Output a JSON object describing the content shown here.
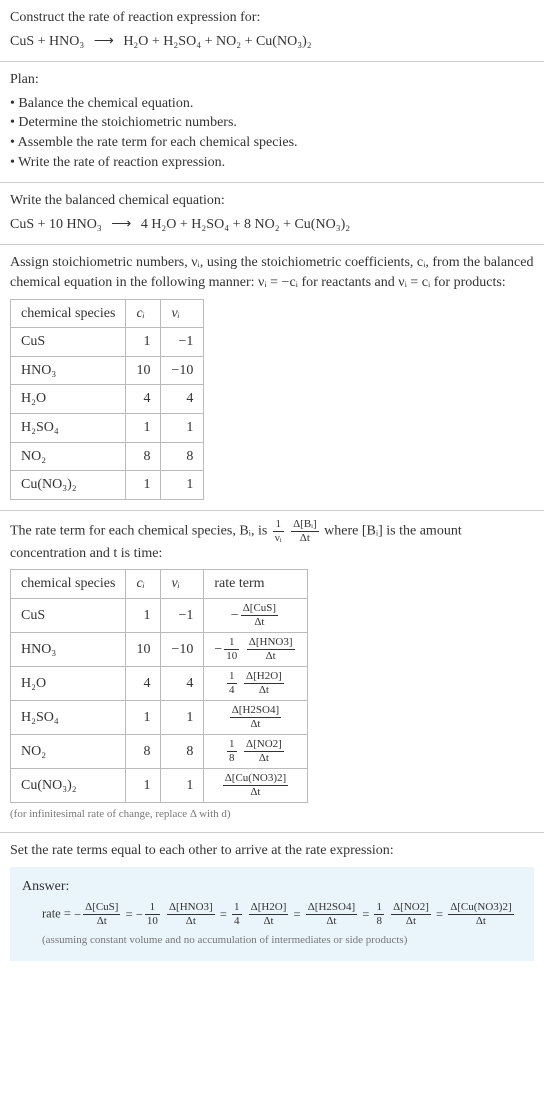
{
  "prompt": {
    "line1": "Construct the rate of reaction expression for:",
    "equation_lhs": "CuS + HNO₃",
    "equation_rhs": "H₂O + H₂SO₄ + NO₂ + Cu(NO₃)₂"
  },
  "plan": {
    "header": "Plan:",
    "items": [
      "Balance the chemical equation.",
      "Determine the stoichiometric numbers.",
      "Assemble the rate term for each chemical species.",
      "Write the rate of reaction expression."
    ]
  },
  "balanced": {
    "header": "Write the balanced chemical equation:",
    "equation_lhs": "CuS + 10 HNO₃",
    "equation_rhs": "4 H₂O + H₂SO₄ + 8 NO₂ + Cu(NO₃)₂"
  },
  "stoich_intro": "Assign stoichiometric numbers, νᵢ, using the stoichiometric coefficients, cᵢ, from the balanced chemical equation in the following manner: νᵢ = −cᵢ for reactants and νᵢ = cᵢ for products:",
  "stoich_table": {
    "headers": [
      "chemical species",
      "cᵢ",
      "νᵢ"
    ],
    "rows": [
      {
        "species": "CuS",
        "c": "1",
        "v": "−1"
      },
      {
        "species": "HNO₃",
        "c": "10",
        "v": "−10"
      },
      {
        "species": "H₂O",
        "c": "4",
        "v": "4"
      },
      {
        "species": "H₂SO₄",
        "c": "1",
        "v": "1"
      },
      {
        "species": "NO₂",
        "c": "8",
        "v": "8"
      },
      {
        "species": "Cu(NO₃)₂",
        "c": "1",
        "v": "1"
      }
    ]
  },
  "rate_intro_1": "The rate term for each chemical species, Bᵢ, is ",
  "rate_intro_2": " where [Bᵢ] is the amount concentration and t is time:",
  "rate_frac_left_top": "1",
  "rate_frac_left_bot": "νᵢ",
  "rate_frac_right_top": "Δ[Bᵢ]",
  "rate_frac_right_bot": "Δt",
  "rate_table": {
    "headers": [
      "chemical species",
      "cᵢ",
      "νᵢ",
      "rate term"
    ],
    "rows": [
      {
        "species": "CuS",
        "c": "1",
        "v": "−1",
        "pref": "−",
        "top": "Δ[CuS]",
        "bot": "Δt"
      },
      {
        "species": "HNO₃",
        "c": "10",
        "v": "−10",
        "pref": "−",
        "coef_top": "1",
        "coef_bot": "10",
        "top": "Δ[HNO3]",
        "bot": "Δt"
      },
      {
        "species": "H₂O",
        "c": "4",
        "v": "4",
        "pref": "",
        "coef_top": "1",
        "coef_bot": "4",
        "top": "Δ[H2O]",
        "bot": "Δt"
      },
      {
        "species": "H₂SO₄",
        "c": "1",
        "v": "1",
        "pref": "",
        "top": "Δ[H2SO4]",
        "bot": "Δt"
      },
      {
        "species": "NO₂",
        "c": "8",
        "v": "8",
        "pref": "",
        "coef_top": "1",
        "coef_bot": "8",
        "top": "Δ[NO2]",
        "bot": "Δt"
      },
      {
        "species": "Cu(NO₃)₂",
        "c": "1",
        "v": "1",
        "pref": "",
        "top": "Δ[Cu(NO3)2]",
        "bot": "Δt"
      }
    ]
  },
  "rate_footnote": "(for infinitesimal rate of change, replace Δ with d)",
  "final_header": "Set the rate terms equal to each other to arrive at the rate expression:",
  "answer": {
    "label": "Answer:",
    "prefix": "rate = ",
    "terms": [
      {
        "pref": "−",
        "top": "Δ[CuS]",
        "bot": "Δt"
      },
      {
        "pref": "−",
        "coef_top": "1",
        "coef_bot": "10",
        "top": "Δ[HNO3]",
        "bot": "Δt"
      },
      {
        "coef_top": "1",
        "coef_bot": "4",
        "top": "Δ[H2O]",
        "bot": "Δt"
      },
      {
        "top": "Δ[H2SO4]",
        "bot": "Δt"
      },
      {
        "coef_top": "1",
        "coef_bot": "8",
        "top": "Δ[NO2]",
        "bot": "Δt"
      },
      {
        "top": "Δ[Cu(NO3)2]",
        "bot": "Δt"
      }
    ],
    "assumption": "(assuming constant volume and no accumulation of intermediates or side products)"
  },
  "chart_data": {
    "type": "table",
    "title": "Stoichiometric numbers and rate terms",
    "columns": [
      "species",
      "c_i",
      "nu_i",
      "rate_term"
    ],
    "rows": [
      [
        "CuS",
        1,
        -1,
        "-(Δ[CuS]/Δt)"
      ],
      [
        "HNO3",
        10,
        -10,
        "-(1/10)(Δ[HNO3]/Δt)"
      ],
      [
        "H2O",
        4,
        4,
        "(1/4)(Δ[H2O]/Δt)"
      ],
      [
        "H2SO4",
        1,
        1,
        "(Δ[H2SO4]/Δt)"
      ],
      [
        "NO2",
        8,
        8,
        "(1/8)(Δ[NO2]/Δt)"
      ],
      [
        "Cu(NO3)2",
        1,
        1,
        "(Δ[Cu(NO3)2]/Δt)"
      ]
    ]
  }
}
